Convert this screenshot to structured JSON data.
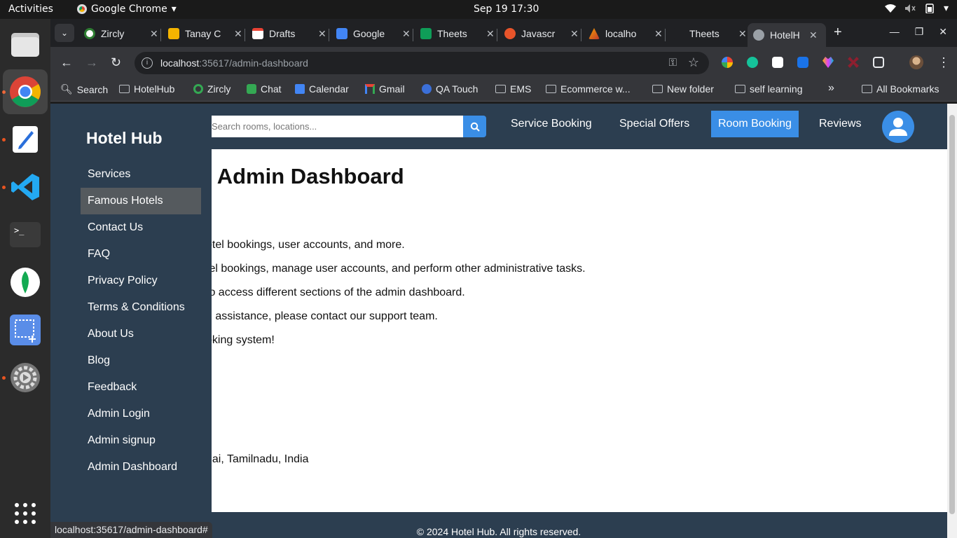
{
  "system": {
    "activities": "Activities",
    "app_name": "Google Chrome",
    "clock": "Sep 19  17:30"
  },
  "tabs": [
    {
      "label": "Zircly",
      "color": "#2e7d32"
    },
    {
      "label": "Tanay C",
      "color": "#f4b400"
    },
    {
      "label": "Drafts",
      "color": "#ea4335"
    },
    {
      "label": "Google",
      "color": "#4285f4"
    },
    {
      "label": "Theets",
      "color": "#0f9d58"
    },
    {
      "label": "Javascr",
      "color": "#e8542a"
    },
    {
      "label": "localho",
      "color": "#f4a100"
    },
    {
      "label": "Theets",
      "color": "#202124"
    },
    {
      "label": "HotelH",
      "color": "#9aa0a6"
    }
  ],
  "browser": {
    "url_host": "localhost",
    "url_path": ":35617/admin-dashboard",
    "status_url": "localhost:35617/admin-dashboard#"
  },
  "bookmarks": [
    {
      "label": "Search",
      "icon": "search-icon"
    },
    {
      "label": "HotelHub",
      "icon": "folder-icon"
    },
    {
      "label": "Zircly",
      "icon": "zircly-icon"
    },
    {
      "label": "Chat",
      "icon": "chat-icon"
    },
    {
      "label": "Calendar",
      "icon": "calendar-icon"
    },
    {
      "label": "Gmail",
      "icon": "gmail-icon"
    },
    {
      "label": "QA Touch",
      "icon": "qatouch-icon"
    },
    {
      "label": "EMS",
      "icon": "folder-icon"
    },
    {
      "label": "Ecommerce w...",
      "icon": "folder-icon"
    },
    {
      "label": "New folder",
      "icon": "folder-icon"
    },
    {
      "label": "self learning",
      "icon": "folder-icon"
    },
    {
      "label": "All Bookmarks",
      "icon": "folder-icon"
    }
  ],
  "site": {
    "search_placeholder": "Search rooms, locations...",
    "nav": {
      "service_booking": "Service Booking",
      "special_offers": "Special Offers",
      "room_booking": "Room Booking",
      "reviews": "Reviews"
    },
    "title": "e Admin Dashboard",
    "lines": [
      "otel bookings, user accounts, and more.",
      "tel bookings, manage user accounts, and perform other administrative tasks.",
      " to access different sections of the admin dashboard.",
      "d assistance, please contact our support team.",
      "oking system!"
    ],
    "address": "nai, Tamilnadu, India",
    "footer": "© 2024 Hotel Hub. All rights reserved.",
    "accent": "#3a8ee6",
    "header_bg": "#2c3e50"
  },
  "sidebar": {
    "brand": "Hotel Hub",
    "items": [
      "Services",
      "Famous Hotels",
      "Contact Us",
      "FAQ",
      "Privacy Policy",
      "Terms & Conditions",
      "About Us",
      "Blog",
      "Feedback",
      "Admin Login",
      "Admin signup",
      "Admin Dashboard"
    ]
  }
}
